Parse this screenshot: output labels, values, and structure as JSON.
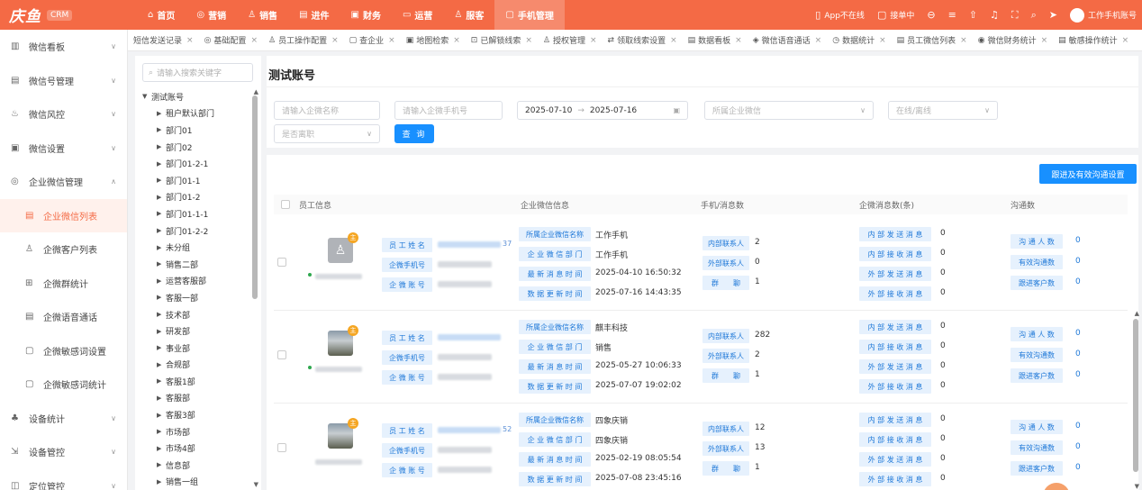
{
  "app": {
    "logo": "庆鱼",
    "badge": "CRM"
  },
  "topnav": [
    {
      "icon": "⌂",
      "label": "首页"
    },
    {
      "icon": "◎",
      "label": "营销"
    },
    {
      "icon": "♙",
      "label": "销售"
    },
    {
      "icon": "▤",
      "label": "进件"
    },
    {
      "icon": "▣",
      "label": "财务"
    },
    {
      "icon": "▭",
      "label": "运营"
    },
    {
      "icon": "♙",
      "label": "服客"
    },
    {
      "icon": "▢",
      "label": "手机管理"
    }
  ],
  "topright": {
    "app_status": "App不在线",
    "connect": "接单中",
    "account": "工作手机账号"
  },
  "sidebar": [
    {
      "label": "微信看板",
      "icon": "▥"
    },
    {
      "label": "微信号管理",
      "icon": "▤"
    },
    {
      "label": "微信风控",
      "icon": "♨"
    },
    {
      "label": "微信设置",
      "icon": "▣"
    },
    {
      "label": "企业微信管理",
      "icon": "◎"
    },
    {
      "label": "企业微信列表",
      "icon": "▤"
    },
    {
      "label": "企微客户列表",
      "icon": "♙"
    },
    {
      "label": "企微群统计",
      "icon": "⊞"
    },
    {
      "label": "企微语音通话",
      "icon": "▤"
    },
    {
      "label": "企微敏感词设置",
      "icon": "▢"
    },
    {
      "label": "企微敏感词统计",
      "icon": "▢"
    },
    {
      "label": "设备统计",
      "icon": "♣"
    },
    {
      "label": "设备管控",
      "icon": "⇲"
    },
    {
      "label": "定位管控",
      "icon": "◫"
    }
  ],
  "tabs": [
    {
      "icon": "",
      "label": "短信发送记录"
    },
    {
      "icon": "◎",
      "label": "基础配置"
    },
    {
      "icon": "♙",
      "label": "员工操作配置"
    },
    {
      "icon": "▢",
      "label": "查企业"
    },
    {
      "icon": "▣",
      "label": "地图检索"
    },
    {
      "icon": "⊡",
      "label": "已解锁线索"
    },
    {
      "icon": "♙",
      "label": "授权管理"
    },
    {
      "icon": "⇄",
      "label": "领取线索设置"
    },
    {
      "icon": "▤",
      "label": "数据看板"
    },
    {
      "icon": "◈",
      "label": "微信语音通话"
    },
    {
      "icon": "◷",
      "label": "数据统计"
    },
    {
      "icon": "▤",
      "label": "员工微信列表"
    },
    {
      "icon": "◉",
      "label": "微信财务统计"
    },
    {
      "icon": "▤",
      "label": "敏感操作统计"
    }
  ],
  "tree": {
    "search_placeholder": "请输入搜索关键字",
    "root": "测试账号",
    "children": [
      "租户默认部门",
      "部门01",
      "部门02",
      "部门01-2-1",
      "部门01-1",
      "部门01-2",
      "部门01-1-1",
      "部门01-2-2",
      "未分组",
      "销售二部",
      "运营客服部",
      "客服一部",
      "技术部",
      "研发部",
      "事业部",
      "合规部",
      "客服1部",
      "客服部",
      "客服3部",
      "市场部",
      "市场4部",
      "信息部",
      "销售一组"
    ]
  },
  "page_title": "测试账号",
  "filters": {
    "name_placeholder": "请输入企微名称",
    "phone_placeholder": "请输入企微手机号",
    "date_start": "2025-07-10",
    "date_sep": "→",
    "date_end": "2025-07-16",
    "corp_placeholder": "所属企业微信",
    "online_placeholder": "在线/离线",
    "resign_placeholder": "是否离职",
    "search_label": "查 询"
  },
  "setting_button": "跟进及有效沟通设置",
  "columns": [
    "员工信息",
    "企业微信信息",
    "手机/消息数",
    "企微消息数(条)",
    "沟通数"
  ],
  "labels": {
    "emp_name": "员 工 姓 名",
    "emp_phone": "企微手机号",
    "emp_account": "企 微 账 号",
    "corp_name": "所属企业微信名称",
    "corp_dept": "企 业 微 信 部 门",
    "last_msg": "最 新 消 息 时 间",
    "data_update": "数 据 更 新 时 间",
    "internal": "内部联系人",
    "external": "外部联系人",
    "group": "群　　聊",
    "in_send": "内 部 发 送 消 息",
    "in_recv": "内 部 接 收 消 息",
    "ex_send": "外 部 发 送 消 息",
    "ex_recv": "外 部 接 收 消 息",
    "chat_people": "沟 通 人 数",
    "valid_chat": "有效沟通数",
    "follow_customer": "跟进客户数"
  },
  "rows": [
    {
      "main_badge": "主",
      "online": true,
      "avatar": "placeholder",
      "name_suffix": "37",
      "corp_name": "工作手机",
      "corp_dept": "工作手机",
      "last_msg": "2025-04-10 16:50:32",
      "data_update": "2025-07-16 14:43:35",
      "internal": "2",
      "external": "0",
      "group": "1",
      "in_send": "0",
      "in_recv": "0",
      "ex_send": "0",
      "ex_recv": "0",
      "chat_people": "0",
      "valid_chat": "0",
      "follow_customer": "0"
    },
    {
      "main_badge": "主",
      "online": true,
      "avatar": "photo",
      "name_suffix": "",
      "corp_name": "麒丰科技",
      "corp_dept": "销售",
      "last_msg": "2025-05-27 10:06:33",
      "data_update": "2025-07-07 19:02:02",
      "internal": "282",
      "external": "2",
      "group": "1",
      "in_send": "0",
      "in_recv": "0",
      "ex_send": "0",
      "ex_recv": "0",
      "chat_people": "0",
      "valid_chat": "0",
      "follow_customer": "0"
    },
    {
      "main_badge": "主",
      "online": false,
      "avatar": "photo",
      "name_suffix": "52",
      "corp_name": "四象庆销",
      "corp_dept": "四象庆销",
      "last_msg": "2025-02-19 08:05:54",
      "data_update": "2025-07-08 23:45:16",
      "internal": "12",
      "external": "13",
      "group": "1",
      "in_send": "0",
      "in_recv": "0",
      "ex_send": "0",
      "ex_recv": "0",
      "chat_people": "0",
      "valid_chat": "0",
      "follow_customer": "0"
    }
  ],
  "colors": {
    "brand": "#f46a45",
    "primary": "#1890ff",
    "label_bg": "#e6f1fd"
  }
}
